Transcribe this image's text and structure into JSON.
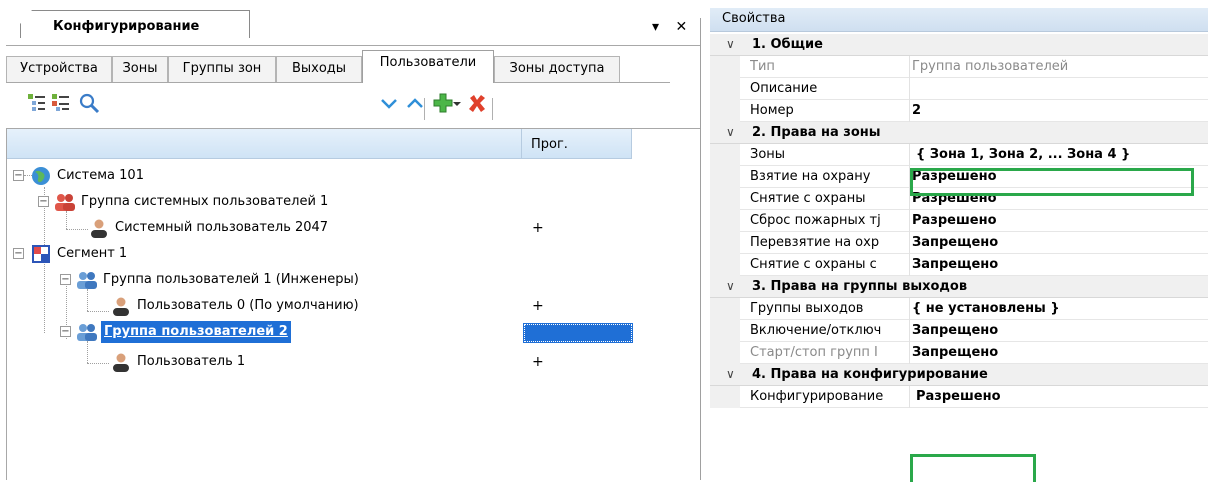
{
  "configuration_panel": {
    "title": "Конфигурирование",
    "controls": {
      "menu": "▾",
      "close": "✕"
    },
    "tabs": [
      {
        "label": "Устройства",
        "active": false
      },
      {
        "label": "Зоны",
        "active": false
      },
      {
        "label": "Группы зон",
        "active": false
      },
      {
        "label": "Выходы",
        "active": false
      },
      {
        "label": "Пользователи",
        "active": true
      },
      {
        "label": "Зоны доступа",
        "active": false
      }
    ],
    "toolbar": {
      "icons": [
        "expand-all-icon",
        "collapse-all-icon",
        "search-icon",
        "move-down-icon",
        "move-up-icon",
        "add-icon",
        "dropdown-arrow-icon",
        "delete-icon"
      ]
    },
    "tree": {
      "column_header": "Прог.",
      "nodes": [
        {
          "label": "Система 101",
          "prog": ""
        },
        {
          "label": "Группа системных пользователей 1",
          "prog": ""
        },
        {
          "label": "Системный пользователь 2047",
          "prog": "+"
        },
        {
          "label": "Сегмент 1",
          "prog": ""
        },
        {
          "label": "Группа пользователей 1 (Инженеры)",
          "prog": ""
        },
        {
          "label": "Пользователь 0 (По умолчанию)",
          "prog": "+"
        },
        {
          "label": "Группа пользователей 2",
          "prog": "",
          "selected": true
        },
        {
          "label": "Пользователь 1",
          "prog": "+"
        }
      ]
    }
  },
  "properties_panel": {
    "title": "Свойства",
    "categories": [
      {
        "label": "1. Общие",
        "rows": [
          {
            "name": "Тип",
            "value": "Группа пользователей",
            "readonly": true
          },
          {
            "name": "Описание",
            "value": ""
          },
          {
            "name": "Номер",
            "value": "2",
            "bold": true
          }
        ]
      },
      {
        "label": "2. Права на зоны",
        "rows": [
          {
            "name": "Зоны",
            "value": "{ Зона 1, Зона 2, ... Зона 4 }",
            "bold": true,
            "highlighted": true
          },
          {
            "name": "Взятие на охрану",
            "value": "Разрешено",
            "bold": true
          },
          {
            "name": "Снятие с охраны",
            "value": "Разрешено",
            "bold": true
          },
          {
            "name": "Сброс пожарных тј",
            "value": "Разрешено",
            "bold": true
          },
          {
            "name": "Перевзятие на охр",
            "value": "Запрещено",
            "bold": true
          },
          {
            "name": "Снятие с охраны с",
            "value": "Запрещено",
            "bold": true
          }
        ]
      },
      {
        "label": "3. Права на группы выходов",
        "rows": [
          {
            "name": "Группы выходов",
            "value": "{ не установлены }",
            "bold": true
          },
          {
            "name": "Включение/отключ",
            "value": "Запрещено",
            "bold": true
          },
          {
            "name": "Старт/стоп групп I",
            "value": "Запрещено",
            "bold": true,
            "readonly_name": true
          }
        ]
      },
      {
        "label": "4. Права на конфигурирование",
        "rows": [
          {
            "name": "Конфигурирование",
            "value": "Разрешено",
            "bold": true,
            "highlighted": true
          }
        ]
      }
    ]
  },
  "colors": {
    "selection": "#1f6fd6",
    "highlight_box": "#2aa84a",
    "category_bg": "#f0f0f0",
    "header_gradient_top": "#e1ecf7"
  }
}
